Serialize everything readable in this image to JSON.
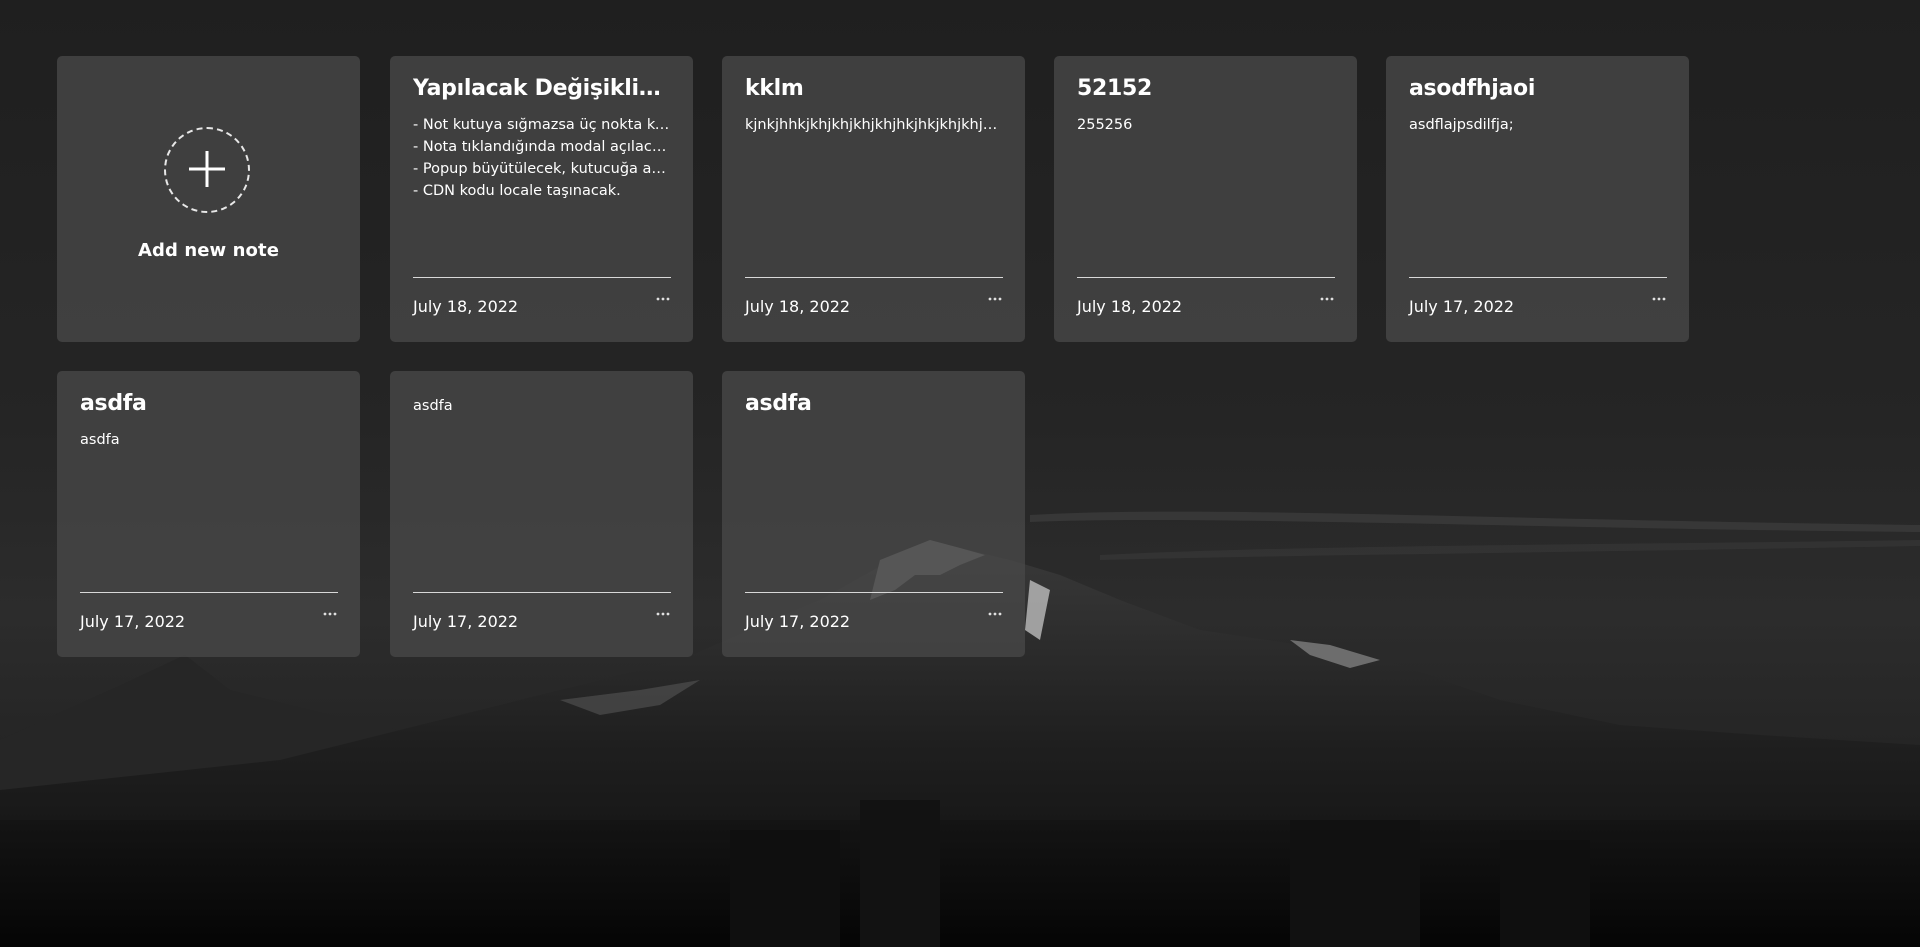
{
  "add_note": {
    "label": "Add new note",
    "icon": "plus-icon"
  },
  "notes": [
    {
      "title": "Yapılacak Değişiklikler",
      "lines": [
        "- Not kutuya sığmazsa üç nokta konulacak.",
        "- Nota tıklandığında modal açılacak.",
        "- Popup büyütülecek, kutucuğa ayarlanacak.",
        "- CDN kodu locale taşınacak."
      ],
      "date": "July 18, 2022"
    },
    {
      "title": "kklm",
      "lines": [
        "kjnkjhhkjkhjkhjkhjkhjhkjhkjkhjkhjhhkjhkjk"
      ],
      "date": "July 18, 2022"
    },
    {
      "title": "52152",
      "lines": [
        "255256"
      ],
      "date": "July 18, 2022"
    },
    {
      "title": "asodfhjaoi",
      "lines": [
        "asdflajpsdilfja;"
      ],
      "date": "July 17, 2022"
    },
    {
      "title": "asdfa",
      "lines": [
        "asdfa"
      ],
      "date": "July 17, 2022"
    },
    {
      "title": "",
      "lines": [
        "asdfa"
      ],
      "date": "July 17, 2022"
    },
    {
      "title": "asdfa",
      "lines": [],
      "date": "July 17, 2022"
    }
  ],
  "menu_icon": "more-dots-icon"
}
